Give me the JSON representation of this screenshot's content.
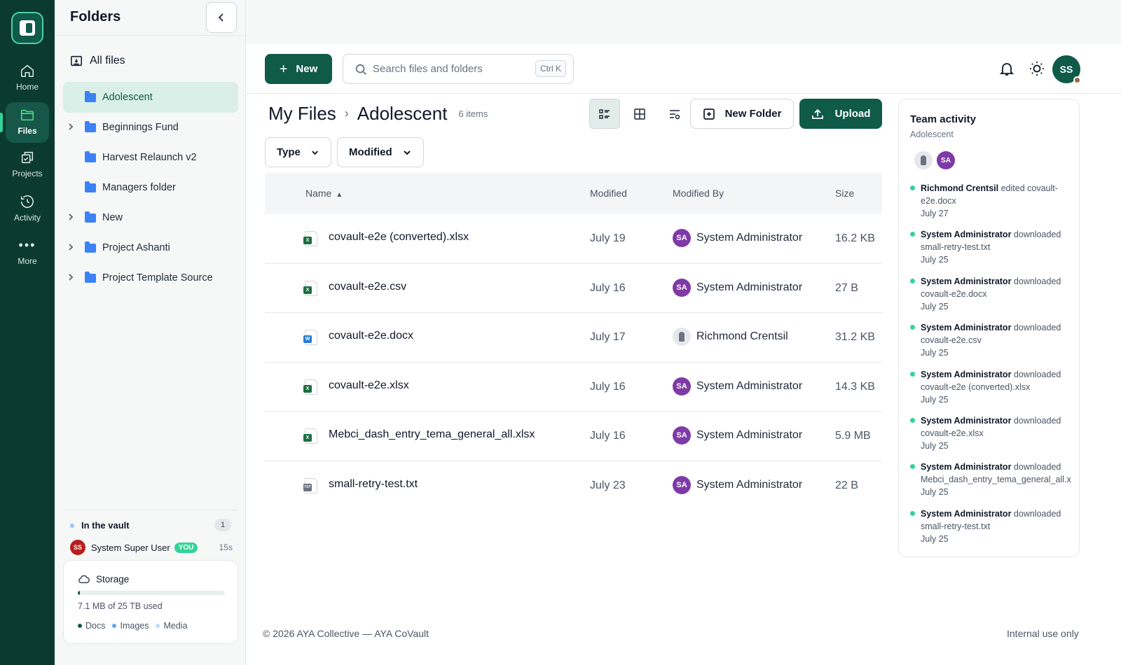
{
  "rail": {
    "items": [
      {
        "label": "Home",
        "icon": "home-icon"
      },
      {
        "label": "Files",
        "icon": "folder-icon"
      },
      {
        "label": "Projects",
        "icon": "projects-icon"
      },
      {
        "label": "Activity",
        "icon": "history-icon"
      },
      {
        "label": "More",
        "icon": "more-icon"
      }
    ]
  },
  "folders": {
    "title": "Folders",
    "all_files": "All files",
    "tree": [
      {
        "name": "Adolescent",
        "expandable": false,
        "selected": true
      },
      {
        "name": "Beginnings Fund",
        "expandable": true
      },
      {
        "name": "Harvest Relaunch v2",
        "expandable": false
      },
      {
        "name": "Managers folder",
        "expandable": false
      },
      {
        "name": "New",
        "expandable": true
      },
      {
        "name": "Project Ashanti",
        "expandable": true
      },
      {
        "name": "Project Template Source",
        "expandable": true
      }
    ],
    "vault": {
      "label": "In the vault",
      "count": "1",
      "user_initials": "SS",
      "user_name": "System Super User",
      "you_badge": "YOU",
      "time": "15s"
    },
    "storage": {
      "title": "Storage",
      "used_fraction": 0.005,
      "used_text": "7.1 MB of 25 TB used",
      "legend": [
        {
          "label": "Docs",
          "color": "#0f5a49"
        },
        {
          "label": "Images",
          "color": "#60a5fa"
        },
        {
          "label": "Media",
          "color": "#bfdbfe"
        }
      ]
    }
  },
  "topbar": {
    "new_label": "New",
    "search_placeholder": "Search files and folders",
    "search_shortcut": "Ctrl K",
    "avatar_initials": "SS"
  },
  "main": {
    "breadcrumb": [
      "My Files",
      "Adolescent"
    ],
    "item_count": "6 items",
    "new_folder_label": "New Folder",
    "upload_label": "Upload",
    "filters": [
      "Type",
      "Modified"
    ],
    "columns": {
      "name": "Name",
      "modified": "Modified",
      "modified_by": "Modified By",
      "size": "Size"
    },
    "files": [
      {
        "name": "covault-e2e (converted).xlsx",
        "type": "xlsx",
        "modified": "July 19",
        "by": "System Administrator",
        "by_initials": "SA",
        "size": "16.2 KB"
      },
      {
        "name": "covault-e2e.csv",
        "type": "csv",
        "modified": "July 16",
        "by": "System Administrator",
        "by_initials": "SA",
        "size": "27 B"
      },
      {
        "name": "covault-e2e.docx",
        "type": "docx",
        "modified": "July 17",
        "by": "Richmond Crentsil",
        "by_initials": "",
        "size": "31.2 KB"
      },
      {
        "name": "covault-e2e.xlsx",
        "type": "xlsx",
        "modified": "July 16",
        "by": "System Administrator",
        "by_initials": "SA",
        "size": "14.3 KB"
      },
      {
        "name": "Mebci_dash_entry_tema_general_all.xlsx",
        "type": "xlsx",
        "modified": "July 16",
        "by": "System Administrator",
        "by_initials": "SA",
        "size": "5.9 MB"
      },
      {
        "name": "small-retry-test.txt",
        "type": "txt",
        "modified": "July 23",
        "by": "System Administrator",
        "by_initials": "SA",
        "size": "22 B"
      }
    ]
  },
  "team": {
    "title": "Team activity",
    "subtitle": "Adolescent",
    "avatar_initials": "SA",
    "activities": [
      {
        "who": "Richmond Crentsil",
        "action": "edited",
        "line1_rest": "covault-",
        "line2": "e2e.docx",
        "date": "July 27"
      },
      {
        "who": "System Administrator",
        "action": "downloaded",
        "line1_rest": "",
        "line2": "small-retry-test.txt",
        "date": "July 25"
      },
      {
        "who": "System Administrator",
        "action": "downloaded",
        "line1_rest": "",
        "line2": "covault-e2e.docx",
        "date": "July 25"
      },
      {
        "who": "System Administrator",
        "action": "downloaded",
        "line1_rest": "",
        "line2": "covault-e2e.csv",
        "date": "July 25"
      },
      {
        "who": "System Administrator",
        "action": "downloaded",
        "line1_rest": "",
        "line2": "covault-e2e (converted).xlsx",
        "date": "July 25"
      },
      {
        "who": "System Administrator",
        "action": "downloaded",
        "line1_rest": "",
        "line2": "covault-e2e.xlsx",
        "date": "July 25"
      },
      {
        "who": "System Administrator",
        "action": "downloaded",
        "line1_rest": "",
        "line2": "Mebci_dash_entry_tema_general_all.x",
        "date": "July 25"
      },
      {
        "who": "System Administrator",
        "action": "downloaded",
        "line1_rest": "",
        "line2": "small-retry-test.txt",
        "date": "July 25"
      }
    ]
  },
  "footer": {
    "left": "© 2026 AYA Collective — AYA CoVault",
    "right": "Internal use only"
  },
  "colors": {
    "brand": "#0f5a49",
    "rail_bg": "#0b3a30",
    "selected_folder_bg": "#d9efe7",
    "avatar_sa": "#7e3aa6",
    "xlsx": "#1d6f42",
    "docx": "#2b7cd3",
    "txt": "#6b7280",
    "activity_dot": "#34d399"
  }
}
